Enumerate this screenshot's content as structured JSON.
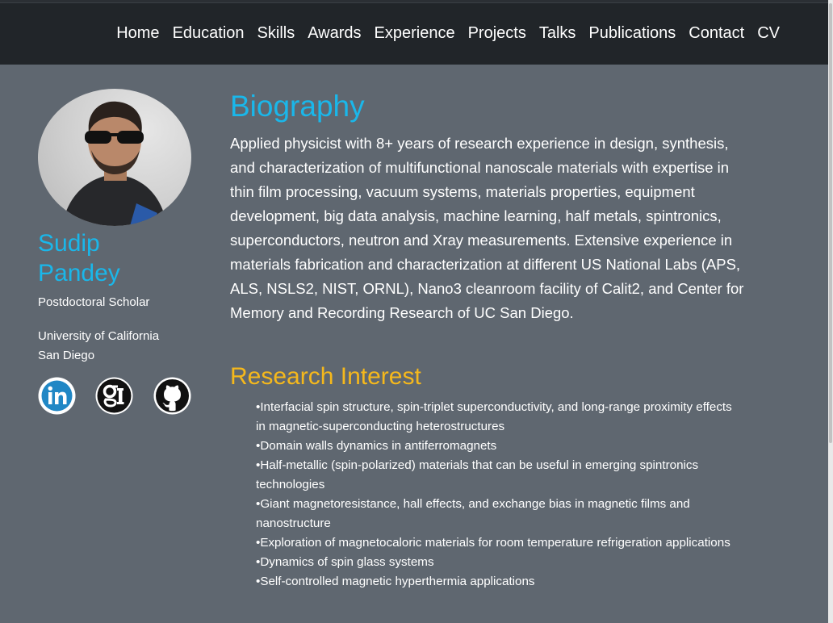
{
  "nav": {
    "items": [
      "Home",
      "Education",
      "Skills",
      "Awards",
      "Experience",
      "Projects",
      "Talks",
      "Publications",
      "Contact",
      "CV"
    ]
  },
  "profile": {
    "first_name": "Sudip",
    "last_name": "Pandey",
    "role": "Postdoctoral Scholar",
    "university_line1": "University of California",
    "university_line2": "San Diego",
    "social_icons": [
      "linkedin-icon",
      "google-scholar-icon",
      "github-icon"
    ]
  },
  "biography": {
    "title": "Biography",
    "text": "Applied physicist with 8+ years of research experience in design, synthesis, and characterization of multifunctional nanoscale materials with expertise in thin film processing, vacuum systems, materials properties, equipment development, big data analysis, machine learning, half metals, spintronics, superconductors, neutron and Xray measurements. Extensive experience in materials fabrication and characterization at different US National Labs (APS, ALS, NSLS2, NIST, ORNL), Nano3 cleanroom facility of Calit2, and Center for Memory and Recording Research of UC San Diego."
  },
  "research": {
    "title": "Research Interest",
    "items": [
      "•Interfacial spin structure, spin-triplet superconductivity, and long-range proximity effects in magnetic-superconducting heterostructures",
      "•Domain walls dynamics in antiferromagnets",
      "•Half-metallic (spin-polarized) materials that can be useful in emerging spintronics technologies",
      "•Giant magnetoresistance, hall effects, and exchange bias in magnetic films and nanostructure",
      "•Exploration of magnetocaloric materials for room temperature refrigeration applications",
      "•Dynamics of spin glass systems",
      "•Self-controlled magnetic hyperthermia applications"
    ]
  },
  "colors": {
    "background": "#5f6770",
    "navbar": "#212529",
    "accent_blue": "#1ab7ea",
    "accent_orange": "#f5b81c"
  }
}
